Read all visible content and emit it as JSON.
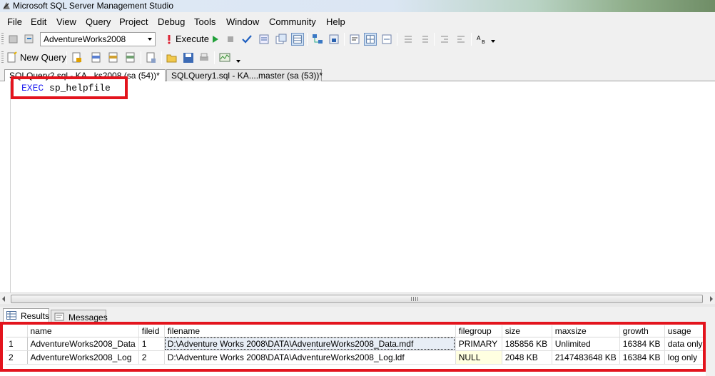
{
  "window": {
    "title": "Microsoft SQL Server Management Studio"
  },
  "menu": [
    "File",
    "Edit",
    "View",
    "Query",
    "Project",
    "Debug",
    "Tools",
    "Window",
    "Community",
    "Help"
  ],
  "toolbar": {
    "database": "AdventureWorks2008",
    "execute_label": "Execute",
    "new_query_label": "New Query"
  },
  "tabs": {
    "active": "SQLQuery2.sql - KA...ks2008 (sa (54))*",
    "inactive": "SQLQuery1.sql - KA....master (sa (53))*"
  },
  "editor": {
    "keyword": "EXEC",
    "identifier": "sp_helpfile"
  },
  "results": {
    "tab_results": "Results",
    "tab_messages": "Messages",
    "columns": [
      "name",
      "fileid",
      "filename",
      "filegroup",
      "size",
      "maxsize",
      "growth",
      "usage"
    ],
    "rows": [
      [
        "1",
        "AdventureWorks2008_Data",
        "1",
        "D:\\Adventure Works 2008\\DATA\\AdventureWorks2008_Data.mdf",
        "PRIMARY",
        "185856 KB",
        "Unlimited",
        "16384 KB",
        "data only"
      ],
      [
        "2",
        "AdventureWorks2008_Log",
        "2",
        "D:\\Adventure Works 2008\\DATA\\AdventureWorks2008_Log.ldf",
        "NULL",
        "2048 KB",
        "2147483648 KB",
        "16384 KB",
        "log only"
      ]
    ]
  },
  "colors": {
    "highlight": "#e3141d",
    "keyword": "#1d1df0"
  }
}
